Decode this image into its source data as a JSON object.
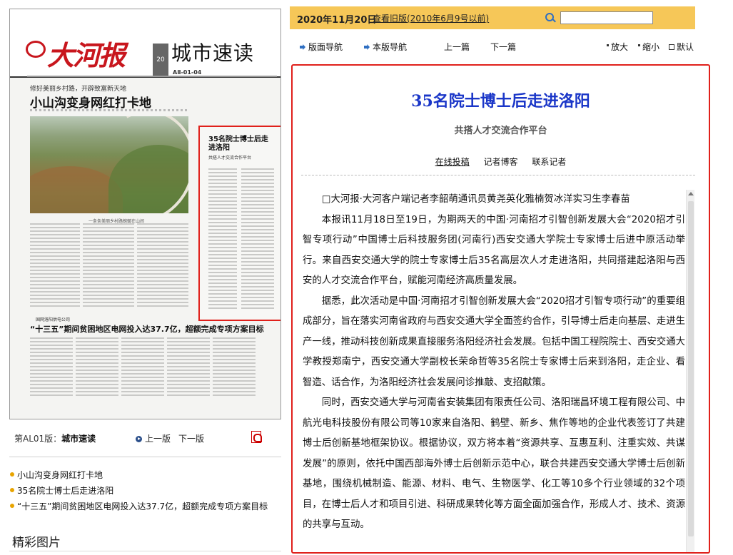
{
  "left": {
    "newspaper": {
      "logo_text": "大河报",
      "section_title": "城市速读",
      "page_code": "AⅡ-01-04",
      "edition_mark": "20",
      "lead_kicker": "修好美丽乡村路，开辟致富新天地",
      "lead_headline": "小山沟变身网红打卡地",
      "photo_caption": "一条条美丽乡村路蜿蜒在山间",
      "highlight_title": "35名院士博士后走进洛阳",
      "highlight_sub": "共搭人才交流合作平台",
      "bottom_kicker": "国网洛阳供电公司",
      "bottom_headline": "“十三五”期间贫困地区电网投入达37.7亿，超额完成专项方案目标"
    },
    "pager": {
      "label": "第AL01版：",
      "label_bold": "城市速读",
      "prev": "上一版",
      "next": "下一版"
    },
    "articles": [
      "小山沟变身网红打卡地",
      "35名院士博士后走进洛阳",
      "“十三五”期间贫困地区电网投入达37.7亿，超额完成专项方案目标"
    ],
    "gallery_heading": "精彩图片"
  },
  "right": {
    "date": "2020年11月20日",
    "old_edition": "查看旧版(2010年6月9号以前)",
    "search": {
      "value": ""
    },
    "nav": {
      "page_nav": "版面导航",
      "this_nav": "本版导航",
      "prev_article": "上一篇",
      "next_article": "下一篇",
      "zoom_in": "放大",
      "zoom_out": "缩小",
      "default": "默认"
    },
    "article": {
      "title_num": "35",
      "title_rest": "名院士博士后走进洛阳",
      "subtitle": "共搭人才交流合作平台",
      "links": [
        "在线投稿",
        "记者博客",
        "联系记者"
      ],
      "byline": "□大河报·大河客户端记者李韶萌通讯员黄尧英化雅楠贺冰洋实习生李春苗",
      "paragraphs": [
        "本报讯11月18日至19日，为期两天的中国·河南招才引智创新发展大会“2020招才引智专项行动”中国博士后科技服务团(河南行)西安交通大学院士专家博士后进中原活动举行。来自西安交通大学的院士专家博士后35名高层次人才走进洛阳，共同搭建起洛阳与西安的人才交流合作平台，赋能河南经济高质量发展。",
        "据悉，此次活动是中国·河南招才引智创新发展大会“2020招才引智专项行动”的重要组成部分，旨在落实河南省政府与西安交通大学全面签约合作，引导博士后走向基层、走进生产一线，推动科技创新成果直接服务洛阳经济社会发展。包括中国工程院院士、西安交通大学教授郑南宁，西安交通大学副校长荣命哲等35名院士专家博士后来到洛阳，走企业、看智造、话合作，为洛阳经济社会发展问诊推敲、支招献策。",
        "同时，西安交通大学与河南省安装集团有限责任公司、洛阳瑞昌环境工程有限公司、中航光电科技股份有限公司等10家来自洛阳、鹤壁、新乡、焦作等地的企业代表签订了共建博士后创新基地框架协议。根据协议，双方将本着“资源共享、互惠互利、注重实效、共谋发展”的原则，依托中国西部海外博士后创新示范中心，联合共建西安交通大学博士后创新基地，围绕机械制造、能源、材料、电气、生物医学、化工等10多个行业领域的32个项目，在博士后人才和项目引进、科研成果转化等方面全面加强合作，形成人才、技术、资源的共享与互动。"
      ]
    }
  },
  "colors": {
    "accent": "#e0201b",
    "title_blue": "#1a36c8",
    "date_bar": "#f6c758",
    "icon_blue": "#2f6fc2"
  }
}
